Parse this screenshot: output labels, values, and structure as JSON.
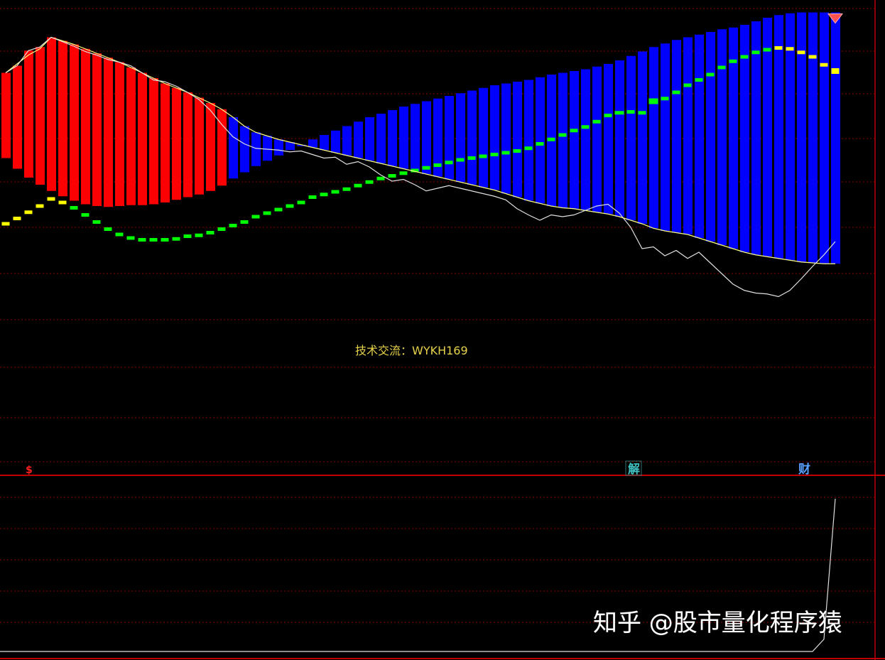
{
  "main_panel": {
    "contact_text": "技术交流：WYKH169",
    "markers": [
      {
        "index": 2,
        "label": "$",
        "color": "#ff2020",
        "kind": "red-dollar"
      },
      {
        "index": 55,
        "label": "解",
        "color": "#40c0c0",
        "kind": "boxed"
      },
      {
        "index": 70,
        "label": "财",
        "color": "#5aa0ff",
        "kind": "plain"
      }
    ]
  },
  "watermark": "知乎 @股市量化程序猿",
  "colors": {
    "background": "#000000",
    "grid": "#8a0000",
    "separator": "#c00000",
    "price_line": "#e0e0e0",
    "avg_line": "#ffff80",
    "bar_up": "#ff0000",
    "bar_down": "#0000ff",
    "dash_green": "#00ff00",
    "dash_yellow": "#ffff00",
    "text_yellow": "#e6d24a",
    "diamond": "#ff5050"
  },
  "chart_data": {
    "type": "line",
    "x": [
      0,
      1,
      2,
      3,
      4,
      5,
      6,
      7,
      8,
      9,
      10,
      11,
      12,
      13,
      14,
      15,
      16,
      17,
      18,
      19,
      20,
      21,
      22,
      23,
      24,
      25,
      26,
      27,
      28,
      29,
      30,
      31,
      32,
      33,
      34,
      35,
      36,
      37,
      38,
      39,
      40,
      41,
      42,
      43,
      44,
      45,
      46,
      47,
      48,
      49,
      50,
      51,
      52,
      53,
      54,
      55,
      56,
      57,
      58,
      59,
      60,
      61,
      62,
      63,
      64,
      65,
      66,
      67,
      68,
      69,
      70,
      71,
      72,
      73
    ],
    "series": [
      {
        "role": "price",
        "values": [
          5.0,
          4.2,
          2.5,
          2.1,
          1.0,
          1.5,
          2.0,
          2.6,
          3.0,
          3.5,
          3.8,
          4.2,
          5.0,
          5.8,
          6.0,
          6.5,
          7.2,
          8.0,
          9.2,
          10.8,
          12.2,
          13.0,
          13.5,
          13.6,
          13.7,
          13.9,
          13.8,
          14.2,
          14.6,
          14.5,
          15.3,
          15.0,
          15.6,
          16.5,
          17.2,
          17.0,
          17.6,
          18.3,
          18.0,
          17.7,
          18.0,
          18.3,
          18.6,
          18.9,
          19.3,
          20.3,
          21.0,
          21.6,
          21.0,
          21.2,
          21.0,
          20.5,
          20.0,
          19.8,
          20.8,
          22.4,
          24.8,
          24.6,
          25.6,
          25.0,
          25.9,
          25.2,
          26.4,
          27.6,
          28.8,
          29.5,
          29.8,
          29.9,
          30.2,
          29.5,
          28.2,
          26.8,
          25.5,
          24.0
        ]
      },
      {
        "role": "avg",
        "values": [
          5.0,
          4.0,
          3.0,
          2.3,
          1.0,
          1.4,
          1.8,
          2.3,
          2.8,
          3.3,
          3.8,
          4.4,
          5.0,
          5.6,
          6.2,
          6.7,
          7.2,
          7.8,
          8.4,
          9.1,
          10.0,
          11.0,
          11.7,
          12.1,
          12.5,
          12.8,
          13.1,
          13.4,
          13.7,
          14.0,
          14.3,
          14.6,
          14.9,
          15.2,
          15.5,
          15.8,
          16.1,
          16.4,
          16.7,
          17.0,
          17.3,
          17.6,
          17.9,
          18.2,
          18.6,
          19.0,
          19.4,
          19.7,
          20.0,
          20.2,
          20.3,
          20.5,
          20.7,
          20.9,
          21.2,
          21.6,
          22.0,
          22.5,
          22.8,
          23.0,
          23.2,
          23.6,
          24.0,
          24.4,
          24.8,
          25.2,
          25.5,
          25.7,
          25.9,
          26.1,
          26.3,
          26.4,
          26.5,
          26.5
        ]
      },
      {
        "role": "dash",
        "values": [
          22.0,
          21.4,
          20.7,
          20.0,
          19.2,
          19.6,
          20.2,
          21.0,
          21.8,
          22.6,
          23.2,
          23.6,
          23.8,
          23.8,
          23.8,
          23.7,
          23.4,
          23.3,
          23.0,
          22.6,
          22.2,
          21.8,
          21.2,
          20.8,
          20.4,
          20.0,
          19.6,
          19.0,
          18.7,
          18.4,
          18.1,
          17.7,
          17.3,
          16.9,
          16.6,
          16.3,
          16.0,
          15.7,
          15.4,
          15.1,
          14.8,
          14.6,
          14.4,
          14.2,
          14.0,
          13.8,
          13.5,
          13.0,
          12.5,
          12.0,
          11.5,
          11.1,
          10.5,
          9.8,
          9.5,
          9.4,
          9.5,
          8.2,
          7.9,
          7.2,
          6.4,
          5.8,
          5.2,
          4.4,
          3.7,
          3.2,
          2.7,
          2.4,
          2.2,
          2.3,
          2.7,
          3.2,
          4.1,
          4.8
        ]
      },
      {
        "role": "bar_top",
        "values": [
          14.6,
          15.8,
          16.8,
          17.6,
          18.3,
          18.9,
          19.4,
          19.8,
          20.0,
          20.1,
          20.0,
          19.9,
          19.9,
          19.8,
          19.6,
          19.3,
          19.0,
          18.7,
          18.3,
          17.7,
          16.9,
          16.2,
          15.5,
          14.9,
          14.3,
          13.7,
          13.1,
          12.5,
          12.0,
          11.5,
          11.0,
          10.5,
          10.0,
          9.6,
          9.2,
          8.8,
          8.5,
          8.2,
          7.9,
          7.6,
          7.3,
          7.0,
          6.7,
          6.4,
          6.2,
          6.0,
          5.8,
          5.5,
          5.2,
          5.0,
          4.8,
          4.6,
          4.3,
          4.0,
          3.6,
          3.1,
          2.6,
          2.1,
          1.7,
          1.3,
          1.0,
          0.7,
          0.4,
          0.1,
          -0.1,
          -0.4,
          -0.8,
          -1.2,
          -1.5,
          -1.7,
          -1.8,
          -1.8,
          -1.8,
          -1.8
        ]
      },
      {
        "role": "bar_bottom",
        "values": [
          5.0,
          4.2,
          2.5,
          2.1,
          1.0,
          1.4,
          1.8,
          2.3,
          2.8,
          3.3,
          3.8,
          4.4,
          5.0,
          5.6,
          6.2,
          6.7,
          7.2,
          7.8,
          8.4,
          9.1,
          10.0,
          11.0,
          11.7,
          12.1,
          12.5,
          12.8,
          13.1,
          13.4,
          13.7,
          14.0,
          14.3,
          14.6,
          14.9,
          15.2,
          15.5,
          15.8,
          16.1,
          16.4,
          16.7,
          17.0,
          17.3,
          17.6,
          17.9,
          18.2,
          18.6,
          19.0,
          19.4,
          19.7,
          20.0,
          20.2,
          20.3,
          20.5,
          20.7,
          20.9,
          21.2,
          21.6,
          22.0,
          22.5,
          22.8,
          23.0,
          23.2,
          23.6,
          24.0,
          24.4,
          24.8,
          25.2,
          25.5,
          25.7,
          25.9,
          26.1,
          26.3,
          26.4,
          26.5,
          26.5
        ]
      },
      {
        "role": "lower_line",
        "values": [
          0,
          0,
          0,
          0,
          0,
          0,
          0,
          0,
          0,
          0,
          0,
          0,
          0,
          0,
          0,
          0,
          0,
          0,
          0,
          0,
          0,
          0,
          0,
          0,
          0,
          0,
          0,
          0,
          0,
          0,
          0,
          0,
          0,
          0,
          0,
          0,
          0,
          0,
          0,
          0,
          0,
          0,
          0,
          0,
          0,
          0,
          0,
          0,
          0,
          0,
          0,
          0,
          0,
          0,
          0,
          0,
          0,
          0,
          0,
          0,
          0,
          0,
          0,
          0,
          0,
          0,
          0,
          0,
          0,
          0,
          0,
          0,
          8,
          100
        ]
      }
    ],
    "bar_color_split_index": 20,
    "dash_yellow_ranges": [
      [
        0,
        5
      ],
      [
        68,
        73
      ]
    ],
    "diamond_index": 73,
    "grid": true
  }
}
